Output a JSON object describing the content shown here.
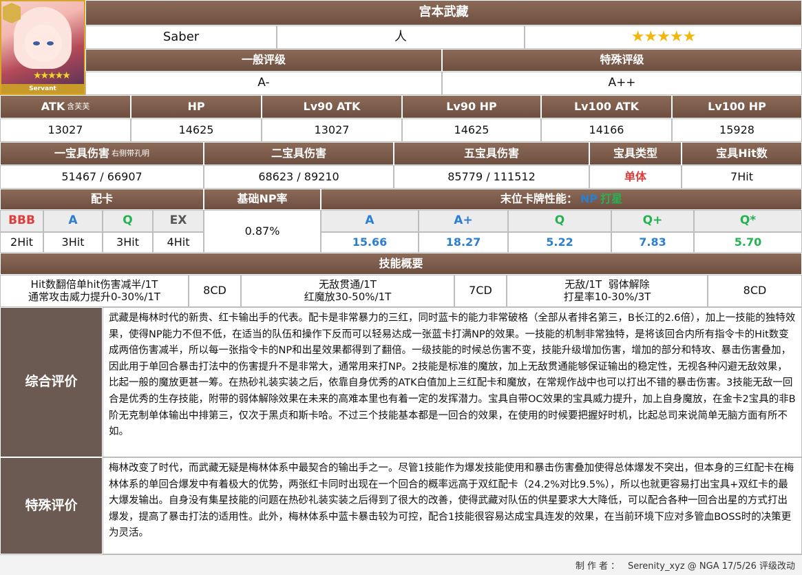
{
  "servant": {
    "name": "宫本武藏",
    "class": "Saber",
    "attribute": "人",
    "rarity": "★★★★★",
    "card_label": "Servant"
  },
  "ratings": {
    "general_label": "一般评级",
    "special_label": "特殊评级",
    "general_value": "A-",
    "special_value": "A++"
  },
  "stats": {
    "headers": [
      "ATK",
      "HP",
      "Lv90 ATK",
      "Lv90 HP",
      "Lv100 ATK",
      "Lv100 HP"
    ],
    "atk_note": "含芙芙",
    "values": [
      "13027",
      "14625",
      "13027",
      "14625",
      "14166",
      "15928"
    ]
  },
  "np": {
    "headers": [
      "一宝具伤害",
      "二宝具伤害",
      "五宝具伤害",
      "宝具类型",
      "宝具Hit数"
    ],
    "np1_note": "右侧带孔明",
    "values": [
      "51467 / 66907",
      "68623 / 89210",
      "85779 / 111512",
      "单体",
      "7Hit"
    ]
  },
  "cards": {
    "header": "配卡",
    "base_np_header": "基础NP率",
    "last_card_header": "末位卡牌性能：",
    "legend_np": "NP",
    "legend_star": "打星",
    "types": [
      "BBB",
      "A",
      "Q",
      "EX"
    ],
    "hits": [
      "2Hit",
      "3Hit",
      "3Hit",
      "4Hit"
    ],
    "base_np": "0.87%",
    "perf_labels": [
      "A",
      "A+",
      "Q",
      "Q+",
      "Q*"
    ],
    "perf_values": [
      "15.66",
      "18.27",
      "5.22",
      "7.83",
      "5.70"
    ]
  },
  "skills": {
    "header": "技能概要",
    "s1_line1": "Hit数翻倍单hit伤害减半/1T",
    "s1_line2": "通常攻击威力提升0-30%/1T",
    "s1_cd": "8CD",
    "s2_line1": "无敌贯通/1T",
    "s2_line2": "红魔放30-50%/1T",
    "s2_cd": "7CD",
    "s3_line1": "无敌/1T  弱体解除",
    "s3_line2": "打星率10-30%/3T",
    "s3_cd": "8CD"
  },
  "review": {
    "overall_label": "综合评价",
    "overall_text": "武藏是梅林时代的新贵、红卡输出手的代表。配卡是非常暴力的三红，同时蓝卡的能力非常破格（全部从者排名第三，B长江的2.6倍），加上一技能的独特效果，使得NP能力不但不低，在适当的队伍和操作下反而可以轻易达成一张蓝卡打满NP的效果。一技能的机制非常独特，是将该回合内所有指令卡的Hit数变成两倍伤害减半，所以每一张指令卡的NP和出星效果都得到了翻倍。一级技能的时候总伤害不变，技能升级增加伤害，增加的部分和特攻、暴击伤害叠加，因此用于单回合暴击打法中的伤害提升不是非常大，通常用来打NP。2技能是标准的魔放，加上无敌贯通能够保证输出的稳定性，无视各种闪避无敌效果，比起一般的魔放更甚一筹。在热砂礼装实装之后，依靠自身优秀的ATK白值加上三红配卡和魔放，在常规作战中也可以打出不错的暴击伤害。3技能无敌一回合是优秀的生存技能，附带的弱体解除效果在未来的高难本里也有着一定的发挥潜力。宝具自带OC效果的宝具威力提升，加上自身魔放，在金卡2宝具的非B阶无克制单体输出中排第三，仅次于黑贞和斯卡哈。不过三个技能基本都是一回合的效果，在使用的时候要把握好时机，比起总司来说简单无脑方面有所不如。",
    "special_label": "特殊评价",
    "special_text": "梅林改变了时代，而武藏无疑是梅林体系中最契合的输出手之一。尽管1技能作为爆发技能使用和暴击伤害叠加使得总体爆发不突出，但本身的三红配卡在梅林体系的单回合爆发中有着极大的优势，两张红卡同时出现在一个回合的概率远高于双红配卡（24.2%对比9.5%），所以也就更容易打出宝具+双红卡的最大爆发输出。自身没有集星技能的问题在热砂礼装实装之后得到了很大的改善，使得武藏对队伍的供星要求大大降低，可以配合各种一回合出星的方式打出爆发，提高了暴击打法的适用性。此外，梅林体系中蓝卡暴击较为可控，配合1技能很容易达成宝具连发的效果，在当前环境下应对多管血BOSS时的决策更为灵活。"
  },
  "footer": {
    "maker_label": "制作者：",
    "credit": "Serenity_xyz @ NGA  17/5/26 评级改动"
  }
}
